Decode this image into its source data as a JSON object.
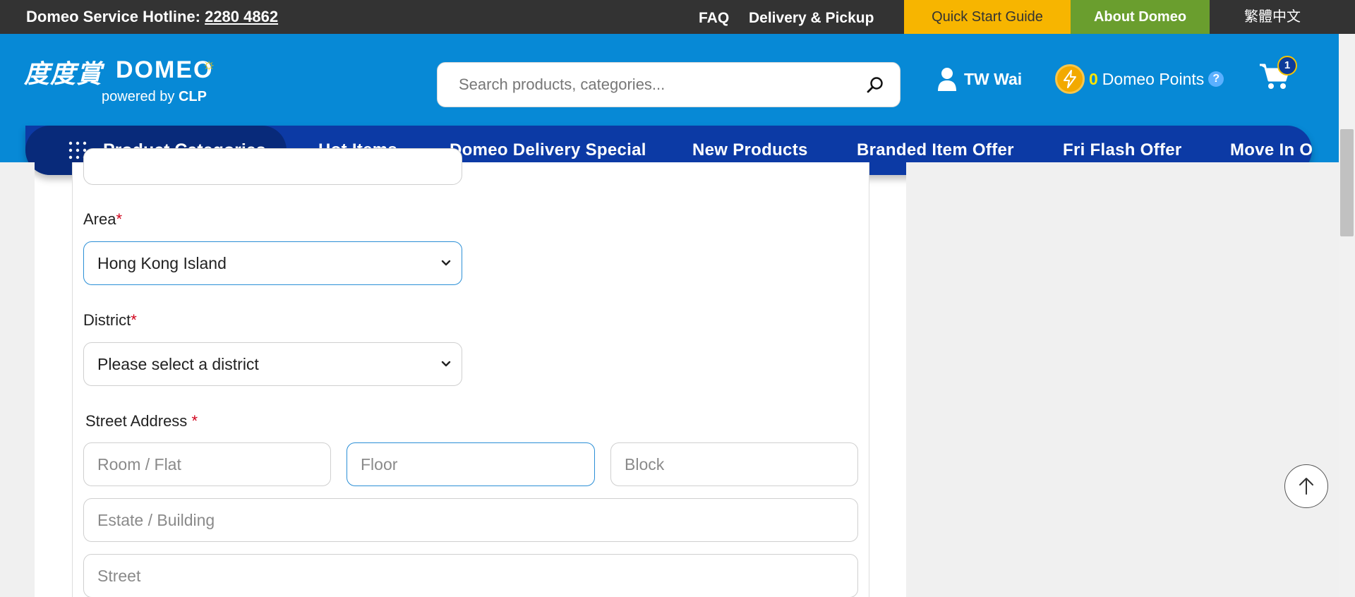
{
  "topbar": {
    "hotline_label": "Domeo Service Hotline:",
    "hotline_number": "2280 4862",
    "faq": "FAQ",
    "delivery": "Delivery & Pickup",
    "quick_start": "Quick Start Guide",
    "about": "About Domeo",
    "language": "繁體中文"
  },
  "logo": {
    "chinese": "度度賞",
    "brand": "DOMEO",
    "tagline": "powered by",
    "tagline_brand": "CLP"
  },
  "search": {
    "placeholder": "Search products, categories..."
  },
  "user": {
    "name": "TW Wai"
  },
  "points": {
    "value": "0",
    "label": "Domeo Points",
    "help": "?"
  },
  "cart": {
    "count": "1"
  },
  "nav": {
    "categories": "Product Categories",
    "items": [
      "Hot Items",
      "Domeo Delivery Special",
      "New Products",
      "Branded Item Offer",
      "Fri Flash Offer",
      "Move In O"
    ]
  },
  "form": {
    "area_label": "Area",
    "area_value": "Hong Kong Island",
    "district_label": "District",
    "district_value": "Please select a district",
    "street_label": "Street Address",
    "required_mark": "*",
    "room_placeholder": "Room / Flat",
    "floor_placeholder": "Floor",
    "block_placeholder": "Block",
    "estate_placeholder": "Estate / Building",
    "street_placeholder": "Street"
  },
  "colors": {
    "topbar": "#333333",
    "header": "#0789d6",
    "nav": "#0c3aa5",
    "quick_start": "#f7b500",
    "about": "#6a9e2e",
    "focus_border": "#2b8fd6",
    "required": "#d0021b"
  }
}
